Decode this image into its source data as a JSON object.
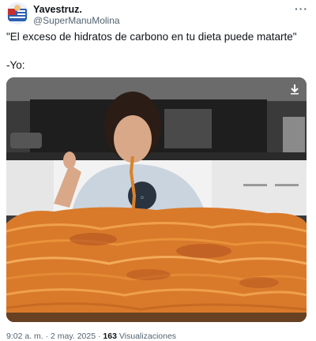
{
  "tweet": {
    "display_name": "Yavestruz.",
    "handle": "@SuperManuMolina",
    "more_label": "···",
    "text": "\"El exceso de hidratos de carbono en tu dieta puede matarte\"\n\n-Yo:",
    "media": {
      "description_icon": "download-arrow-icon"
    },
    "time": "9:02 a. m.",
    "separator": "·",
    "date": "2 may. 2025",
    "views_count": "163",
    "views_label": "Visualizaciones"
  },
  "colors": {
    "text_primary": "#0f1419",
    "text_secondary": "#536471",
    "background": "#ffffff"
  }
}
